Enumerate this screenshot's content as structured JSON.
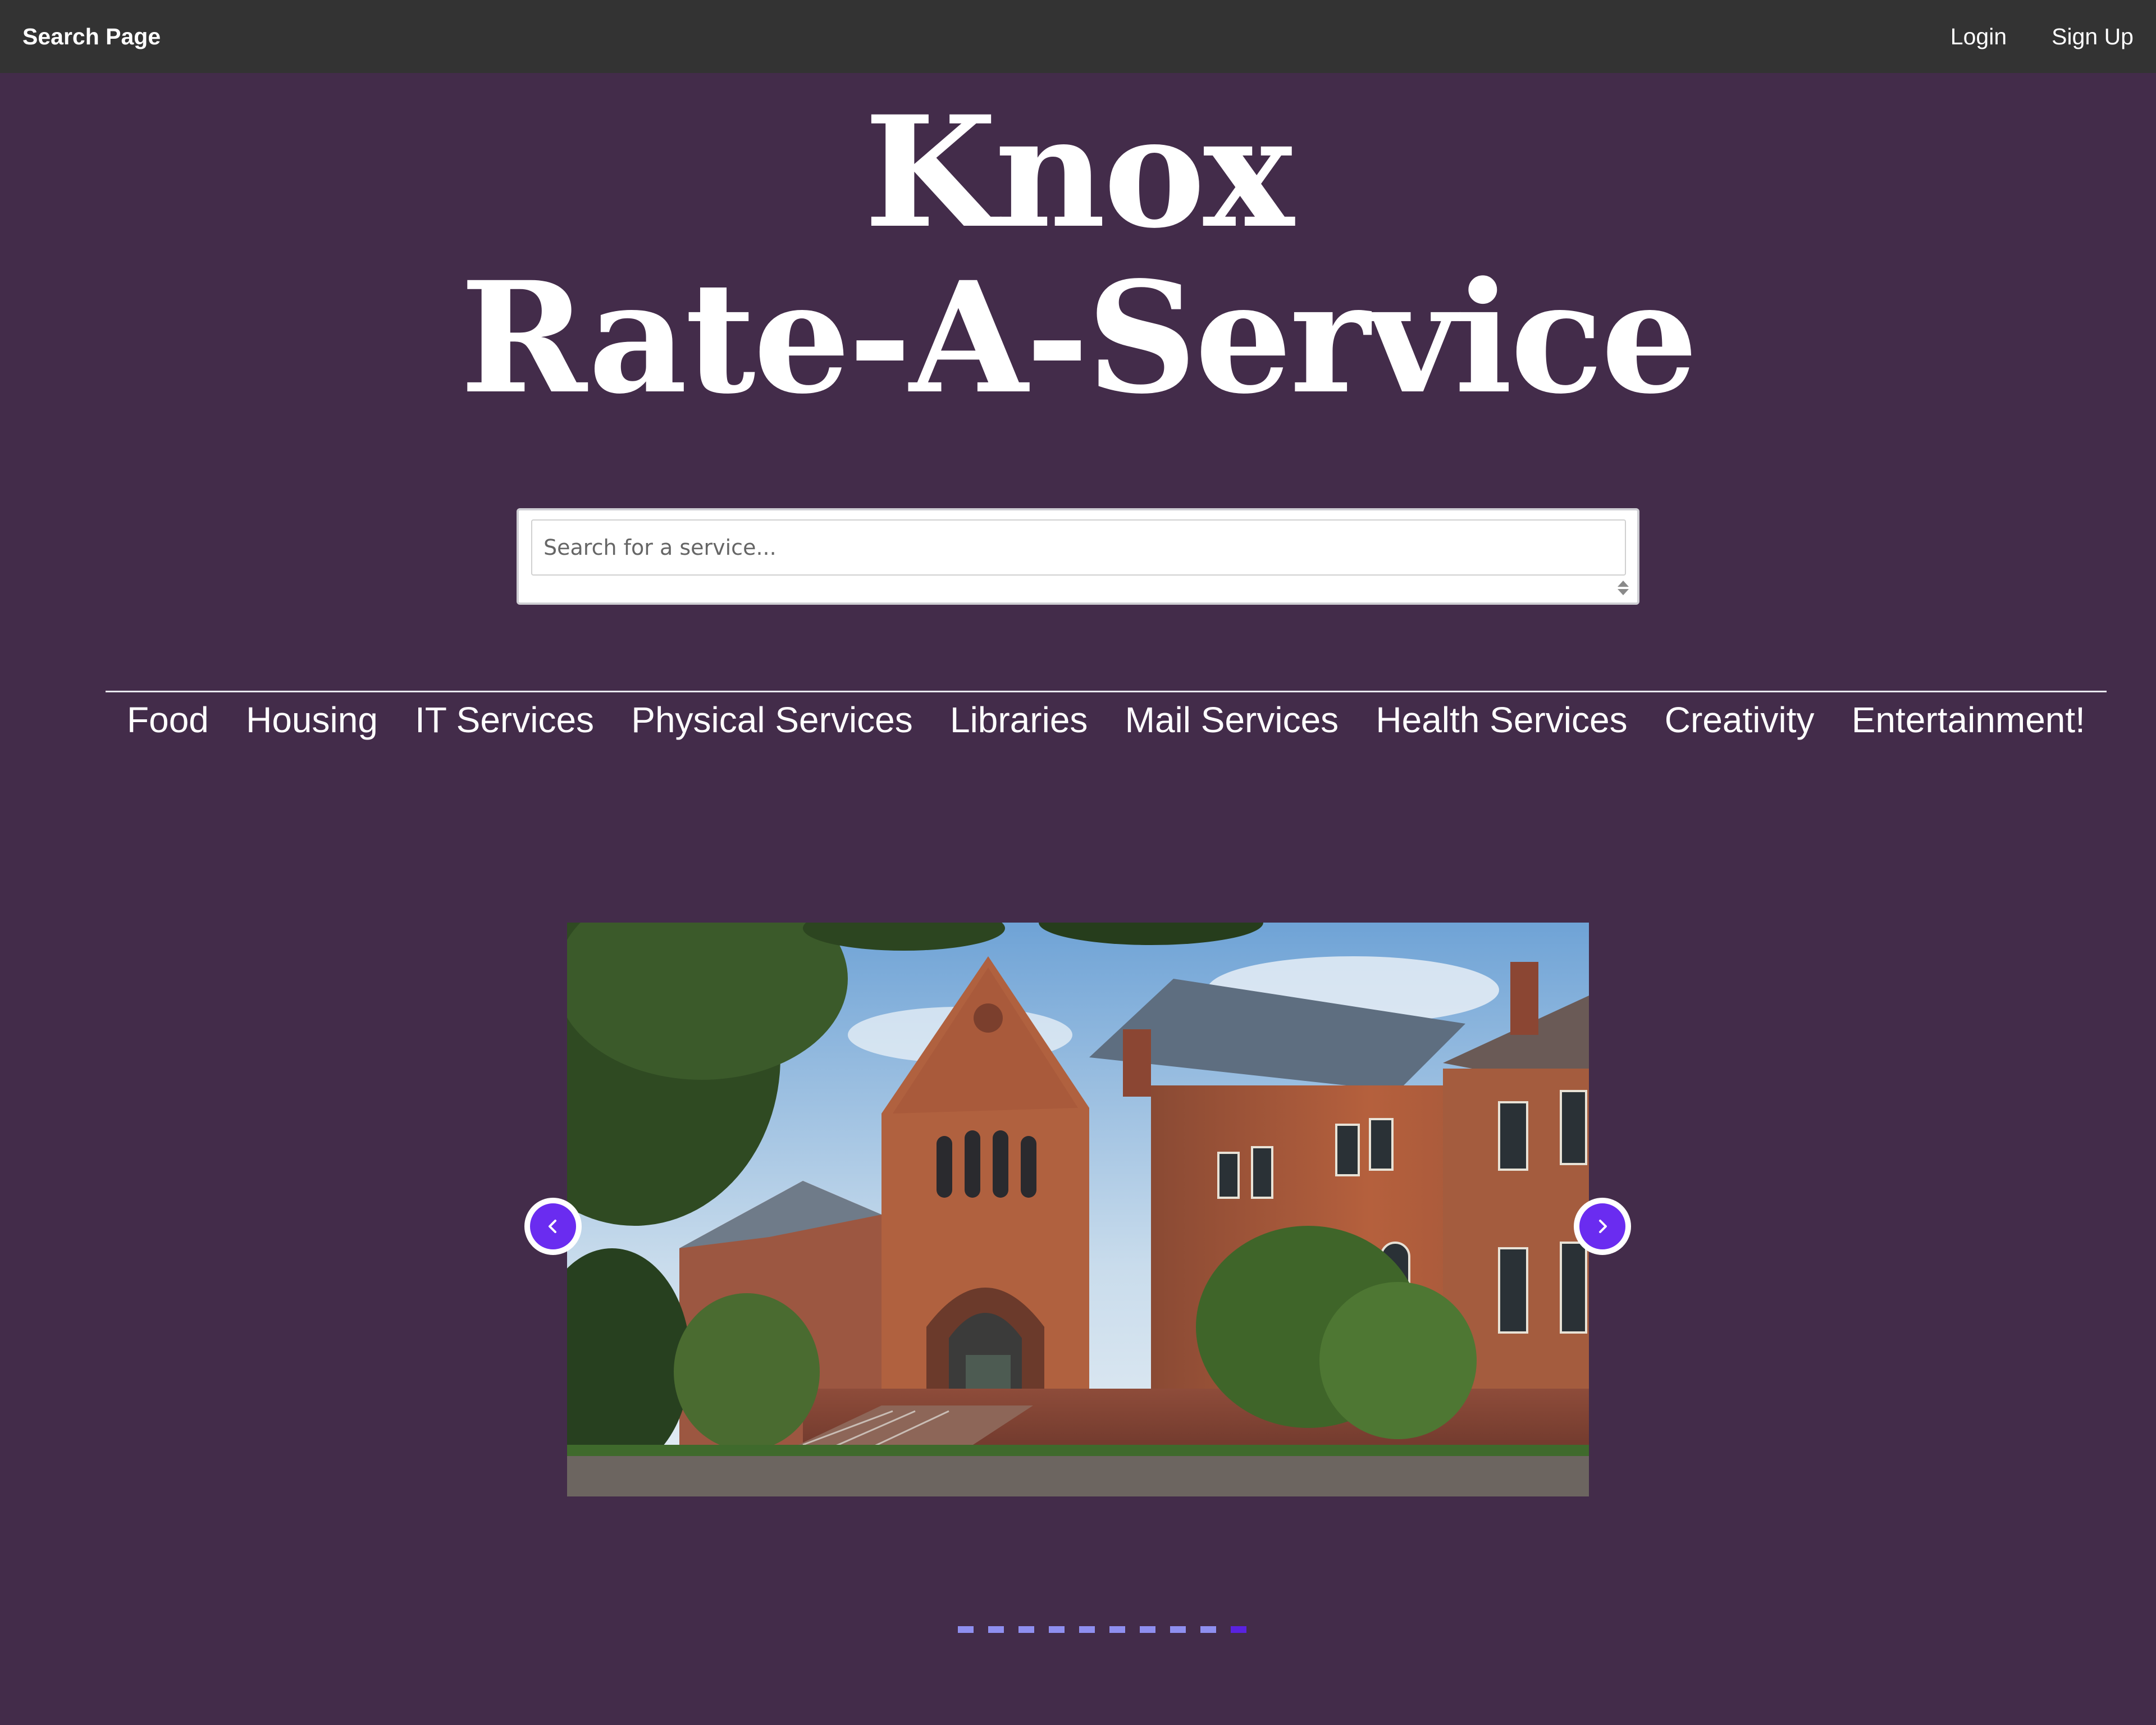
{
  "navbar": {
    "brand": "Search Page",
    "links": [
      {
        "label": "Login"
      },
      {
        "label": "Sign Up"
      }
    ]
  },
  "hero": {
    "title_line1": "Knox",
    "title_line2": "Rate-A-Service"
  },
  "search": {
    "placeholder": "Search for a service..."
  },
  "categories": [
    {
      "label": "Food"
    },
    {
      "label": "Housing"
    },
    {
      "label": "IT Services"
    },
    {
      "label": "Physical Services"
    },
    {
      "label": "Libraries"
    },
    {
      "label": "Mail Services"
    },
    {
      "label": "Health Services"
    },
    {
      "label": "Creativity"
    },
    {
      "label": "Entertainment!"
    }
  ],
  "carousel": {
    "slide_count": 10,
    "active_index": 9,
    "prev_icon": "chevron-left-icon",
    "next_icon": "chevron-right-icon"
  },
  "colors": {
    "background": "#432c4a",
    "navbar": "#333333",
    "accent": "#6a2cf0",
    "dot_inactive": "#8f8ff0",
    "dot_active": "#5a22e0"
  }
}
